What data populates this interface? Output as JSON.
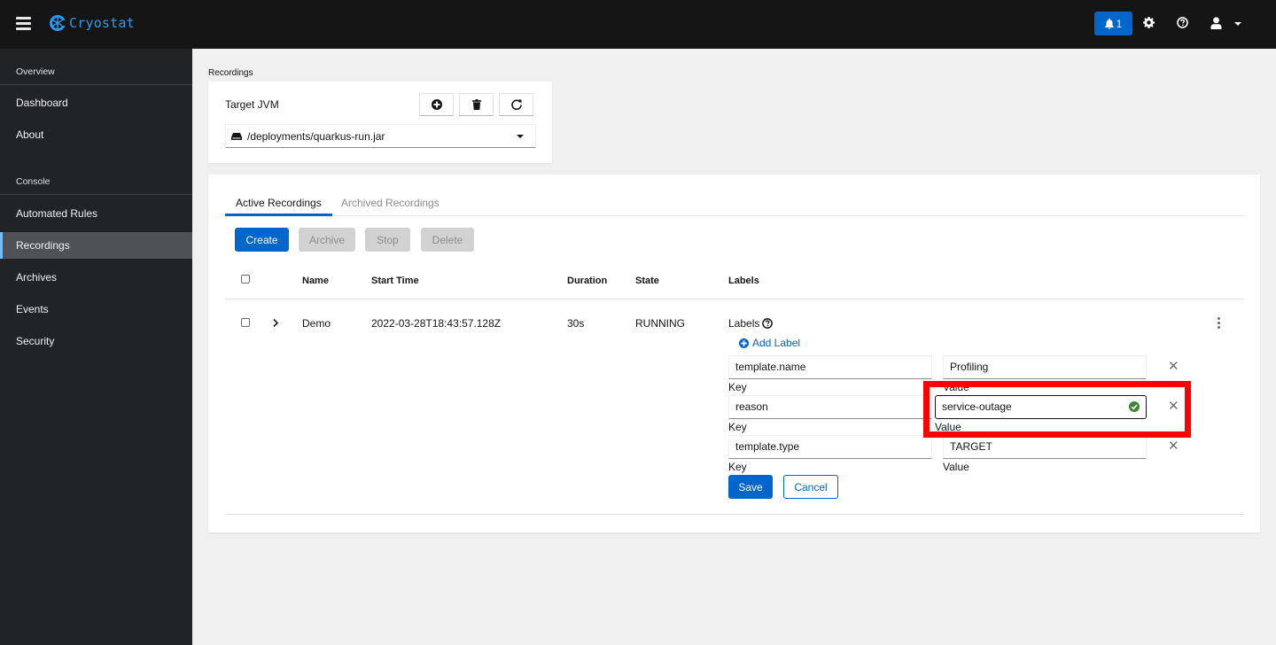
{
  "header": {
    "brand": "Cryostat",
    "notification_count": "1",
    "icons": [
      "menu-icon",
      "cryostat-logo-icon",
      "bell-icon",
      "gear-icon",
      "help-icon",
      "user-icon",
      "caret-down-icon"
    ]
  },
  "sidebar": {
    "sections": [
      {
        "label": "Overview",
        "items": [
          {
            "label": "Dashboard"
          },
          {
            "label": "About"
          }
        ]
      },
      {
        "label": "Console",
        "items": [
          {
            "label": "Automated Rules"
          },
          {
            "label": "Recordings",
            "active": true
          },
          {
            "label": "Archives"
          },
          {
            "label": "Events"
          },
          {
            "label": "Security"
          }
        ]
      }
    ]
  },
  "page": {
    "title": "Recordings",
    "target": {
      "label": "Target JVM",
      "selected": "/deployments/quarkus-run.jar",
      "actions": [
        "add-target",
        "delete-target",
        "refresh-targets"
      ]
    },
    "tabs": [
      {
        "label": "Active Recordings",
        "active": true
      },
      {
        "label": "Archived Recordings",
        "active": false
      }
    ],
    "toolbar": {
      "create": "Create",
      "archive": "Archive",
      "stop": "Stop",
      "delete": "Delete"
    },
    "table": {
      "columns": [
        "Name",
        "Start Time",
        "Duration",
        "State",
        "Labels"
      ],
      "rows": [
        {
          "name": "Demo",
          "start_time": "2022-03-28T18:43:57.128Z",
          "duration": "30s",
          "state": "RUNNING"
        }
      ]
    },
    "labels_editor": {
      "title": "Labels",
      "add_label": "Add Label",
      "key_caption": "Key",
      "value_caption": "Value",
      "labels": [
        {
          "key": "template.name",
          "value": "Profiling"
        },
        {
          "key": "reason",
          "value": "service-outage",
          "valid": true
        },
        {
          "key": "template.type",
          "value": "TARGET"
        }
      ],
      "save": "Save",
      "cancel": "Cancel"
    }
  },
  "colors": {
    "primary": "#0066cc",
    "brand": "#2b9af3",
    "masthead": "#151515",
    "sidebar": "#212427",
    "highlight": "#ff0000",
    "success": "#3e8635"
  }
}
